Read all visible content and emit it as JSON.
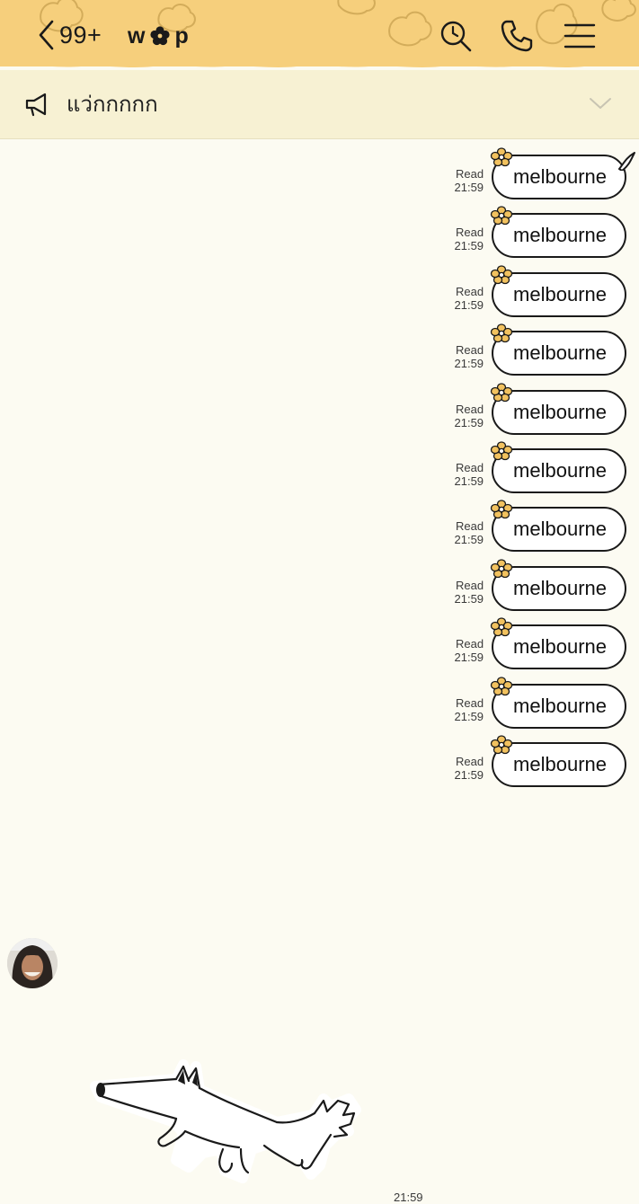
{
  "header": {
    "unread_count": "99+",
    "title_left": "w",
    "title_right": "p",
    "background": "#f6cf7c",
    "icons": [
      "chevron-left-icon",
      "flower-icon",
      "search-icon",
      "phone-icon",
      "menu-icon"
    ]
  },
  "announcement": {
    "text": "แว่กกกกก",
    "icons": [
      "megaphone-icon",
      "chevron-down-icon"
    ]
  },
  "messages": [
    {
      "text": "melbourne",
      "status": "Read",
      "time": "21:59"
    },
    {
      "text": "melbourne",
      "status": "Read",
      "time": "21:59"
    },
    {
      "text": "melbourne",
      "status": "Read",
      "time": "21:59"
    },
    {
      "text": "melbourne",
      "status": "Read",
      "time": "21:59"
    },
    {
      "text": "melbourne",
      "status": "Read",
      "time": "21:59"
    },
    {
      "text": "melbourne",
      "status": "Read",
      "time": "21:59"
    },
    {
      "text": "melbourne",
      "status": "Read",
      "time": "21:59"
    },
    {
      "text": "melbourne",
      "status": "Read",
      "time": "21:59"
    },
    {
      "text": "melbourne",
      "status": "Read",
      "time": "21:59"
    },
    {
      "text": "melbourne",
      "status": "Read",
      "time": "21:59"
    },
    {
      "text": "melbourne",
      "status": "Read",
      "time": "21:59"
    }
  ],
  "incoming": {
    "sticker_time": "21:59",
    "icons": [
      "avatar",
      "dog-sticker"
    ]
  },
  "colors": {
    "chat_background": "#fcfbf2",
    "announce_background": "#f7f1d3",
    "flower_fill": "#f2c25f"
  }
}
